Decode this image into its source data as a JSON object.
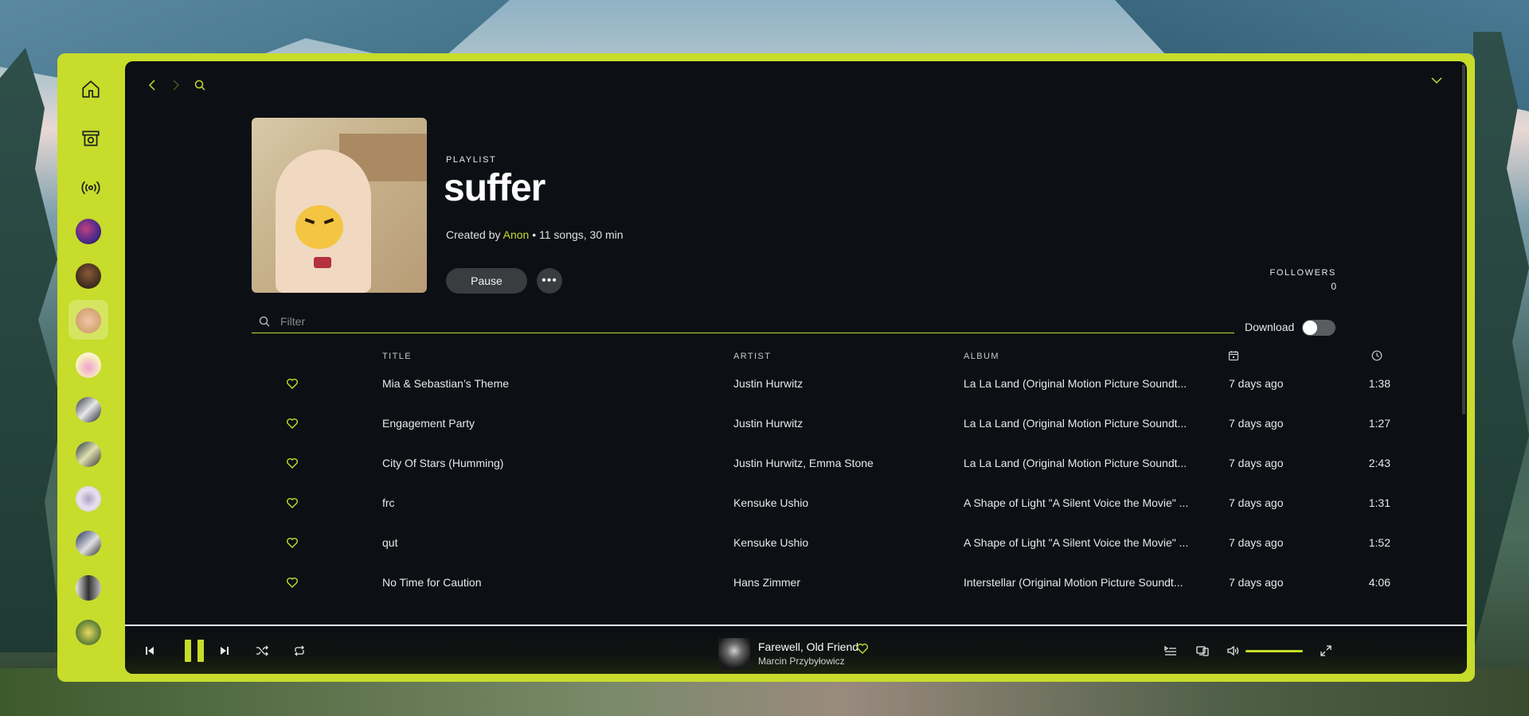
{
  "header": {
    "playlist_type": "PLAYLIST",
    "title": "suffer",
    "created_by_prefix": "Created by",
    "creator": "Anon",
    "meta_suffix": "• 11 songs, 30 min"
  },
  "actions": {
    "pause_label": "Pause",
    "more_label": "•••"
  },
  "followers": {
    "label": "FOLLOWERS",
    "count": "0"
  },
  "filter": {
    "placeholder": "Filter",
    "download_label": "Download",
    "download_enabled": false
  },
  "table": {
    "headers": {
      "title": "TITLE",
      "artist": "ARTIST",
      "album": "ALBUM",
      "date_icon": "calendar-icon",
      "duration_icon": "clock-icon"
    },
    "rows": [
      {
        "title": "Mia & Sebastian’s Theme",
        "artist": "Justin Hurwitz",
        "album": "La La Land (Original Motion Picture Soundt...",
        "added": "7 days ago",
        "duration": "1:38"
      },
      {
        "title": "Engagement Party",
        "artist": "Justin Hurwitz",
        "album": "La La Land (Original Motion Picture Soundt...",
        "added": "7 days ago",
        "duration": "1:27"
      },
      {
        "title": "City Of Stars (Humming)",
        "artist": "Justin Hurwitz, Emma Stone",
        "album": "La La Land (Original Motion Picture Soundt...",
        "added": "7 days ago",
        "duration": "2:43"
      },
      {
        "title": "frc",
        "artist": "Kensuke Ushio",
        "album": "A Shape of Light \"A Silent Voice the Movie\" ...",
        "added": "7 days ago",
        "duration": "1:31"
      },
      {
        "title": "qut",
        "artist": "Kensuke Ushio",
        "album": "A Shape of Light \"A Silent Voice the Movie\" ...",
        "added": "7 days ago",
        "duration": "1:52"
      },
      {
        "title": "No Time for Caution",
        "artist": "Hans Zimmer",
        "album": "Interstellar (Original Motion Picture Soundt...",
        "added": "7 days ago",
        "duration": "4:06"
      }
    ]
  },
  "now_playing": {
    "title": "Farewell, Old Friend",
    "artist": "Marcin Przybyłowicz",
    "liked": true
  },
  "colors": {
    "accent": "#c7dc2b",
    "background": "#0c0f14",
    "text": "#e8e8e8"
  },
  "sidebar": {
    "icons": [
      "home-icon",
      "library-icon",
      "podcast-icon"
    ],
    "playlist_count": 10
  },
  "volume_level": 1.0
}
